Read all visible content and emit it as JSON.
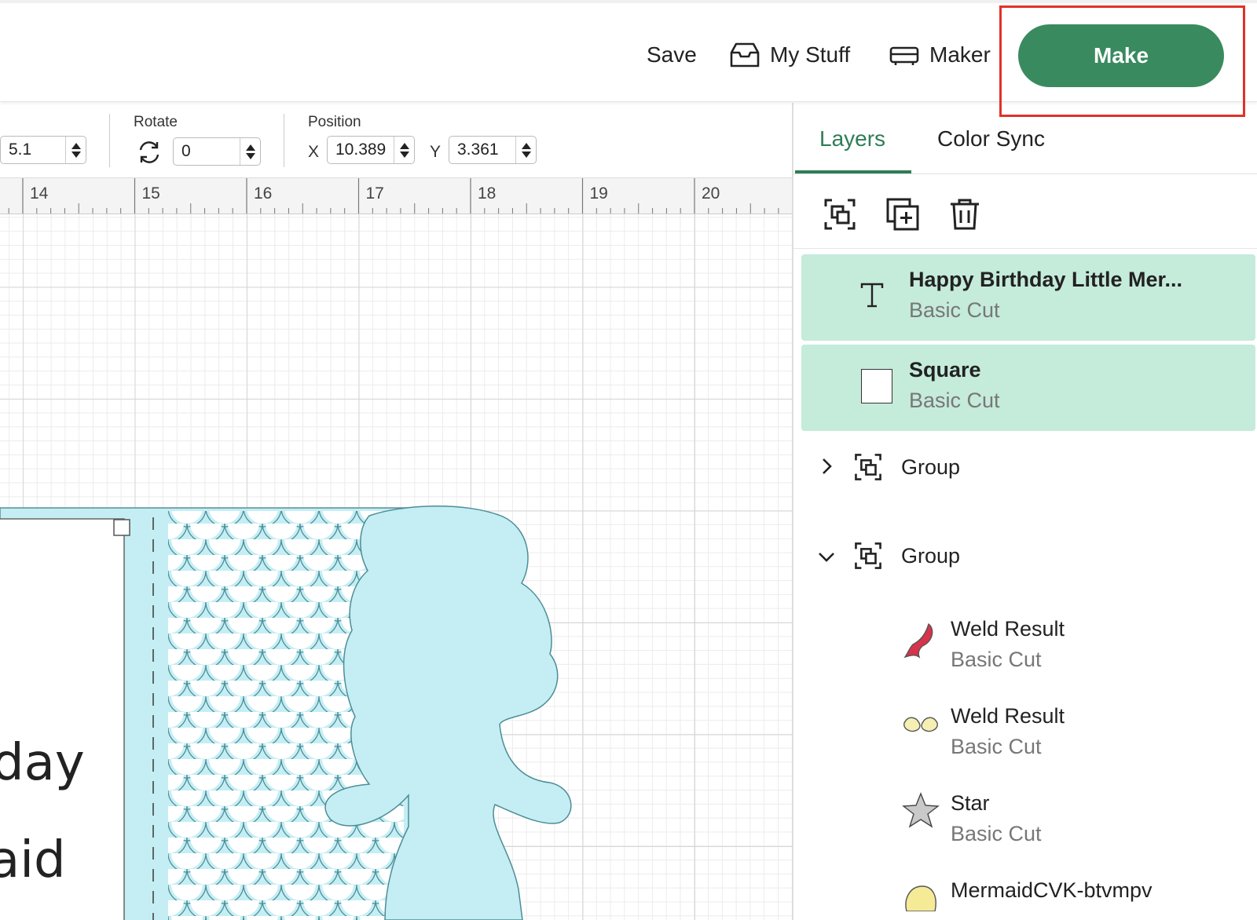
{
  "header": {
    "save_label": "Save",
    "mystuff_label": "My Stuff",
    "maker_label": "Maker",
    "make_label": "Make"
  },
  "toolbar": {
    "size_value": "5.1",
    "rotate_label": "Rotate",
    "rotate_value": "0",
    "position_label": "Position",
    "x_label": "X",
    "x_value": "10.389",
    "y_label": "Y",
    "y_value": "3.361"
  },
  "ruler": {
    "ticks": [
      "14",
      "15",
      "16",
      "17",
      "18",
      "19",
      "20"
    ]
  },
  "canvas": {
    "text_line1": "day",
    "text_line2": "aid"
  },
  "panel": {
    "tabs": [
      {
        "label": "Layers"
      },
      {
        "label": "Color Sync"
      }
    ],
    "layers": [
      {
        "title": "Happy Birthday Little Mer...",
        "sub": "Basic Cut"
      },
      {
        "title": "Square",
        "sub": "Basic Cut"
      },
      {
        "title": "Group"
      },
      {
        "title": "Group"
      },
      {
        "title": "Weld Result",
        "sub": "Basic Cut"
      },
      {
        "title": "Weld Result",
        "sub": "Basic Cut"
      },
      {
        "title": "Star",
        "sub": "Basic Cut"
      },
      {
        "title": "MermaidCVK-btvmpv"
      }
    ]
  },
  "colors": {
    "accent": "#3a8a60",
    "layer_selected_bg": "#c5ebdb",
    "highlight_box": "#e0322a",
    "canvas_shape": "#c4eef4",
    "tail_color": "#d8334a",
    "weld_color": "#f6efb3"
  }
}
